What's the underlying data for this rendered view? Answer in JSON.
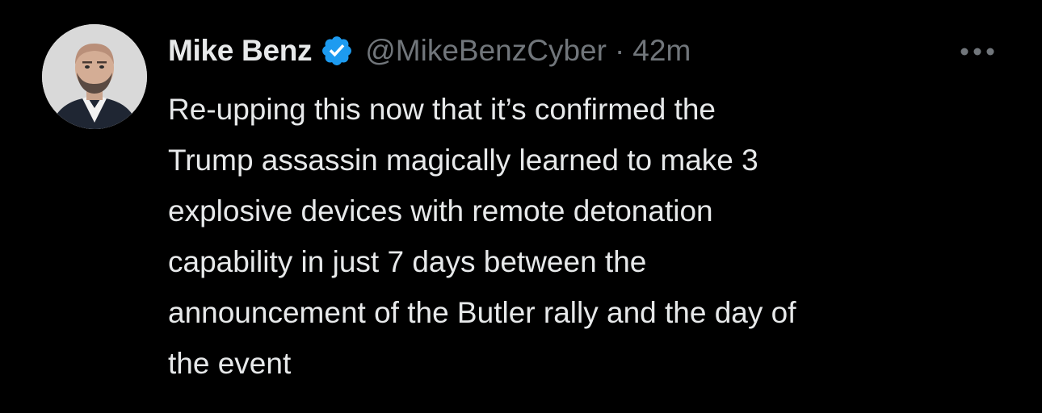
{
  "tweet": {
    "author": {
      "display_name": "Mike Benz",
      "handle": "@MikeBenzCyber",
      "verified": true,
      "avatar_icon": "profile-photo"
    },
    "separator": "·",
    "timestamp": "42m",
    "more_icon": "ellipsis-icon",
    "text_lines": [
      "Re-upping this now that it’s confirmed the",
      "Trump assassin magically learned to make 3",
      "explosive devices with remote detonation",
      "capability in just 7 days between the",
      "announcement of the Butler rally and the day of",
      "the event"
    ]
  },
  "colors": {
    "background": "#000000",
    "primary_text": "#e7e9ea",
    "secondary_text": "#71767b",
    "verified_badge": "#1d9bf0"
  }
}
